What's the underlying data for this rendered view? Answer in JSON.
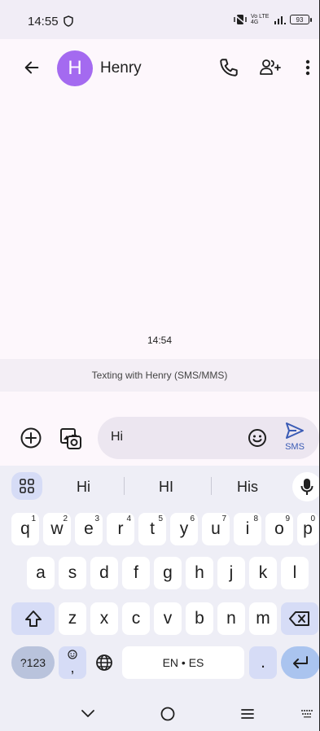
{
  "status_bar": {
    "time": "14:55",
    "network": "Vo LTE 4G",
    "battery": "93"
  },
  "header": {
    "avatar_letter": "H",
    "contact_name": "Henry"
  },
  "conversation": {
    "timestamp": "14:54",
    "banner": "Texting with Henry  (SMS/MMS)"
  },
  "compose": {
    "text": "Hi",
    "send_label": "SMS"
  },
  "keyboard": {
    "suggestions": [
      "Hi",
      "HI",
      "His"
    ],
    "row1": [
      {
        "k": "q",
        "h": "1"
      },
      {
        "k": "w",
        "h": "2"
      },
      {
        "k": "e",
        "h": "3"
      },
      {
        "k": "r",
        "h": "4"
      },
      {
        "k": "t",
        "h": "5"
      },
      {
        "k": "y",
        "h": "6"
      },
      {
        "k": "u",
        "h": "7"
      },
      {
        "k": "i",
        "h": "8"
      },
      {
        "k": "o",
        "h": "9"
      },
      {
        "k": "p",
        "h": "0"
      }
    ],
    "row2": [
      "a",
      "s",
      "d",
      "f",
      "g",
      "h",
      "j",
      "k",
      "l"
    ],
    "row3": [
      "z",
      "x",
      "c",
      "v",
      "b",
      "n",
      "m"
    ],
    "symbols_label": "?123",
    "emoji_comma": ",",
    "space_label": "EN • ES",
    "period": "."
  }
}
